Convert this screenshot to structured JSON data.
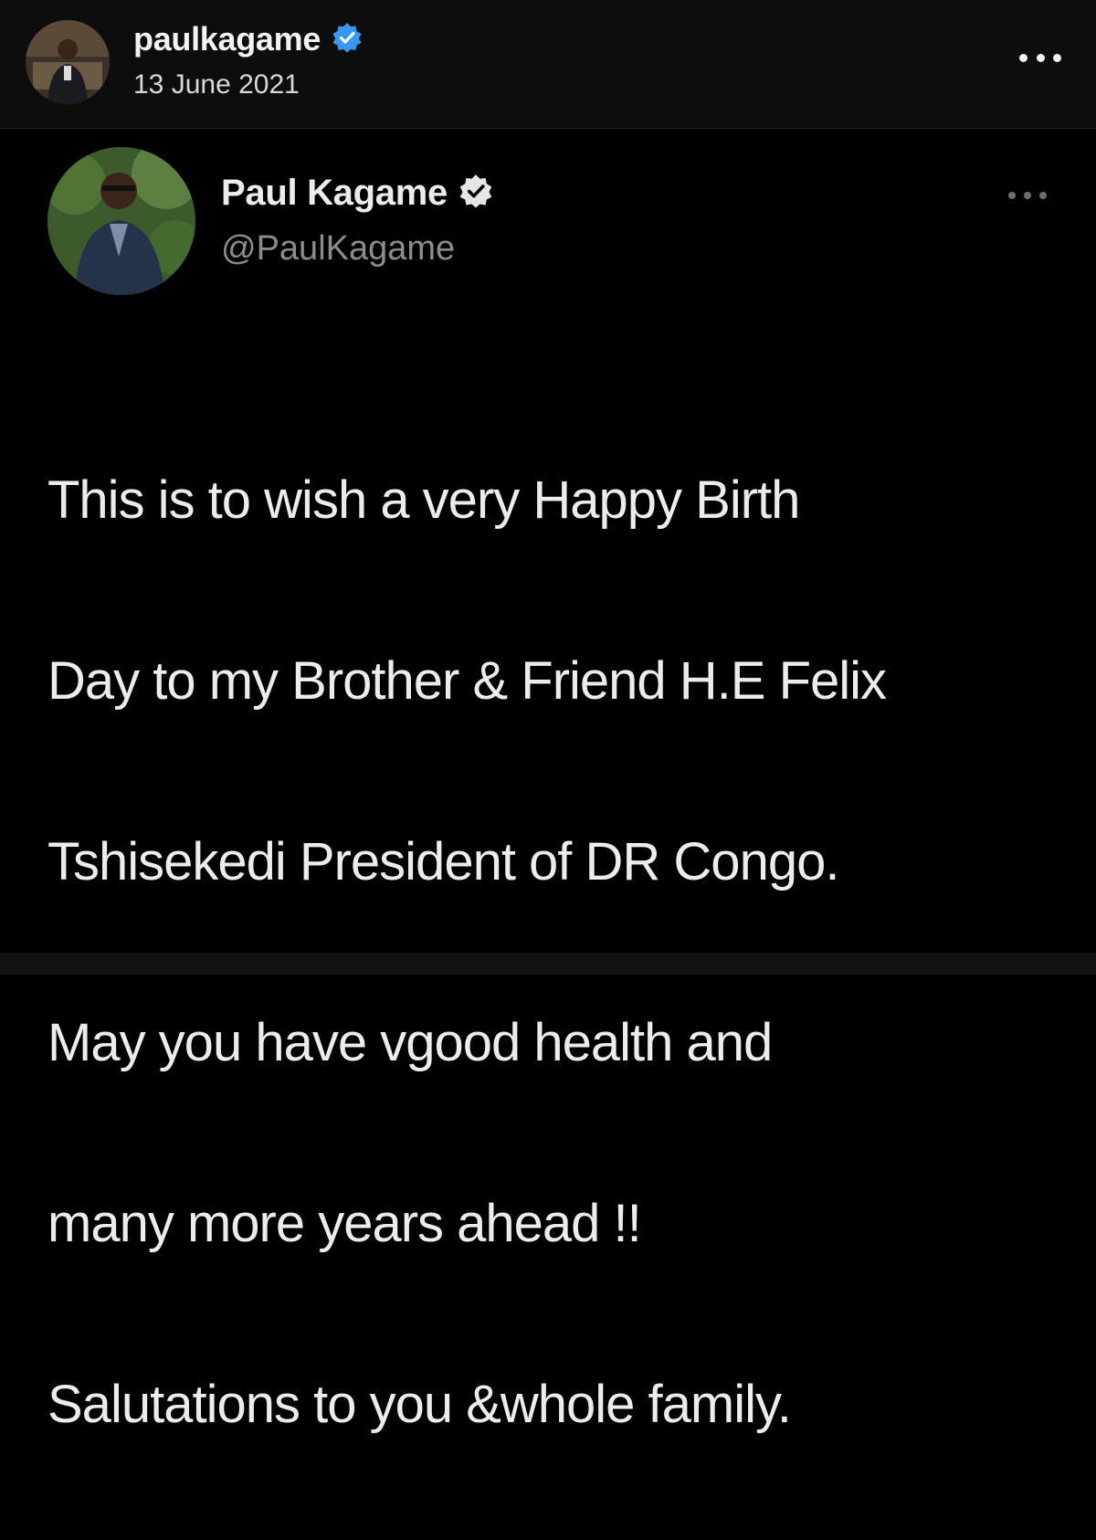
{
  "post_header": {
    "username": "paulkagame",
    "date": "13 June 2021",
    "verified": true,
    "verified_color": "#3897f0",
    "more_icon": "more-horizontal-icon"
  },
  "tweet": {
    "display_name": "Paul Kagame",
    "handle": "@PaulKagame",
    "verified": true,
    "verified_color": "#e6e6e6",
    "more_icon": "more-horizontal-icon",
    "text_lines": [
      "This is to wish a very Happy Birth",
      "Day to my Brother & Friend H.E Felix",
      "Tshisekedi President of  DR Congo.",
      "May you have vgood health and",
      "many more years ahead !!",
      "Salutations to you  &whole family."
    ]
  },
  "theme": {
    "background": "#000000",
    "header_background": "#0d0d0d",
    "text_primary": "#ececec",
    "text_secondary": "#8c8c8c"
  }
}
